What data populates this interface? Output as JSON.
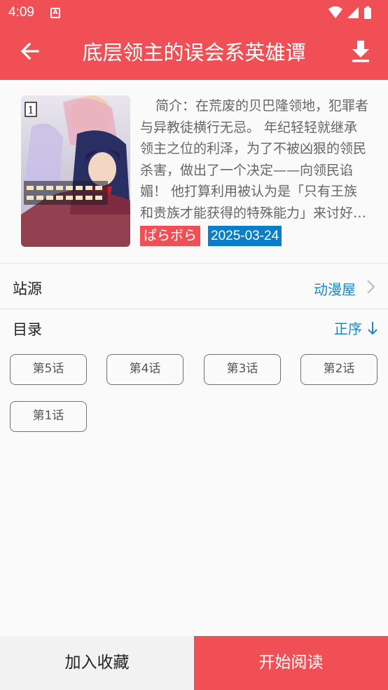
{
  "status_bar": {
    "time": "4:09",
    "icons": [
      "notification-a-icon",
      "wifi-icon",
      "signal-icon",
      "battery-icon"
    ]
  },
  "app_bar": {
    "title": "底层领主的误会系英雄谭",
    "back_icon": "arrow-left-icon",
    "download_icon": "download-icon"
  },
  "comic": {
    "description": "简介：在荒废的贝巴隆领地，犯罪者与异教徒横行无忌。 年纪轻轻就继承领主之位的利泽，为了不被凶狠的领民杀害，做出了一个决定——向领民谄媚！ 他打算利用被认为是「只有王族和贵族才能获得的特殊能力」来讨好领民……",
    "author": "ぱらボら",
    "date": "2025-03-24",
    "cover_volume": "1"
  },
  "source_row": {
    "label": "站源",
    "value": "动漫屋"
  },
  "toc_row": {
    "label": "目录",
    "order": "正序",
    "order_icon": "arrow-down-icon"
  },
  "chapters": [
    "第5话",
    "第4话",
    "第3话",
    "第2话",
    "第1话"
  ],
  "bottom_bar": {
    "favorite_label": "加入收藏",
    "read_label": "开始阅读"
  },
  "colors": {
    "primary": "#f05055",
    "link": "#1b86c8",
    "date_tag": "#0b7ec8"
  }
}
